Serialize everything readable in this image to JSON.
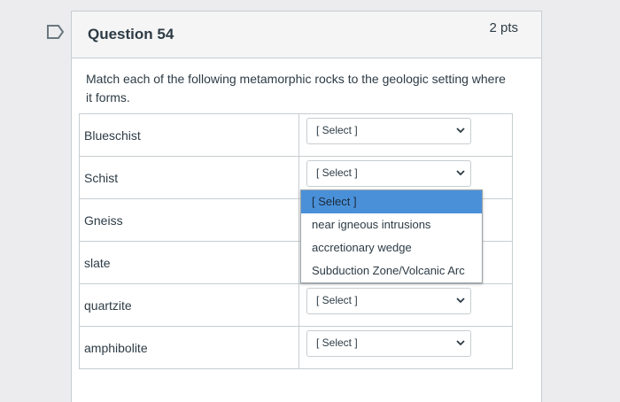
{
  "question": {
    "title": "Question 54",
    "points": "2 pts",
    "prompt": "Match each of the following metamorphic rocks to the geologic setting where it forms."
  },
  "rows": [
    {
      "term": "Blueschist",
      "selected": "[ Select ]"
    },
    {
      "term": "Schist",
      "selected": "[ Select ]"
    },
    {
      "term": "Gneiss",
      "selected": ""
    },
    {
      "term": "slate",
      "selected": ""
    },
    {
      "term": "quartzite",
      "selected": "[ Select ]"
    },
    {
      "term": "amphibolite",
      "selected": "[ Select ]"
    }
  ],
  "dropdown": {
    "options": [
      "[ Select ]",
      "near igneous intrusions",
      "accretionary wedge",
      "Subduction Zone/Volcanic Arc"
    ],
    "highlighted": "[ Select ]"
  },
  "colors": {
    "highlight": "#4a90d9",
    "border": "#c7cdd1"
  },
  "icons": {
    "flag": "flag-icon",
    "chevron": "chevron-down-icon"
  }
}
